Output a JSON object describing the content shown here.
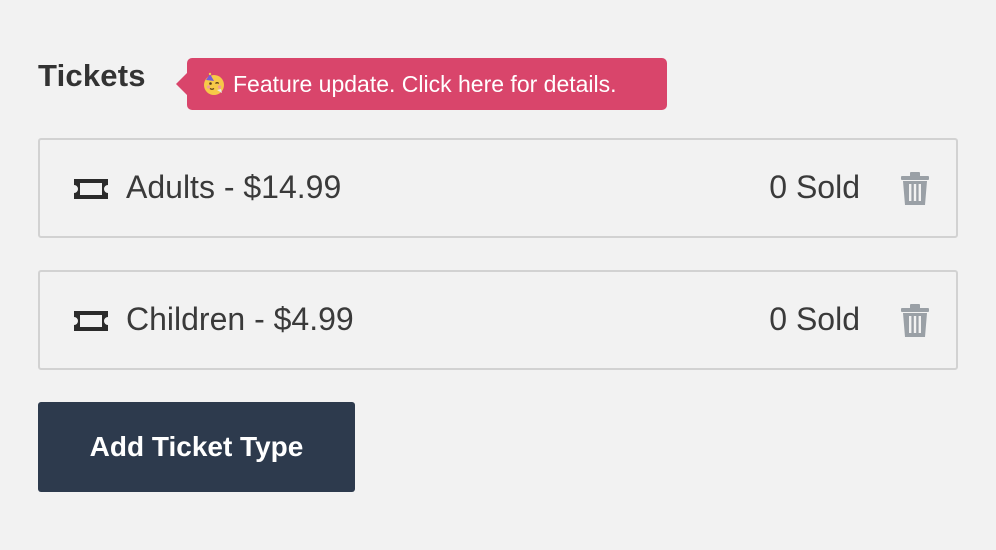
{
  "section": {
    "title": "Tickets"
  },
  "feature_badge": {
    "icon": "party-face-emoji-icon",
    "text": "Feature update. Click here for details.",
    "color": "#d9456b"
  },
  "tickets": [
    {
      "icon": "ticket-icon",
      "label": "Adults - $14.99",
      "sold": "0 Sold",
      "delete_icon": "trash-icon"
    },
    {
      "icon": "ticket-icon",
      "label": "Children - $4.99",
      "sold": "0 Sold",
      "delete_icon": "trash-icon"
    }
  ],
  "actions": {
    "add_ticket_label": "Add Ticket Type",
    "button_color": "#2d3a4d"
  }
}
